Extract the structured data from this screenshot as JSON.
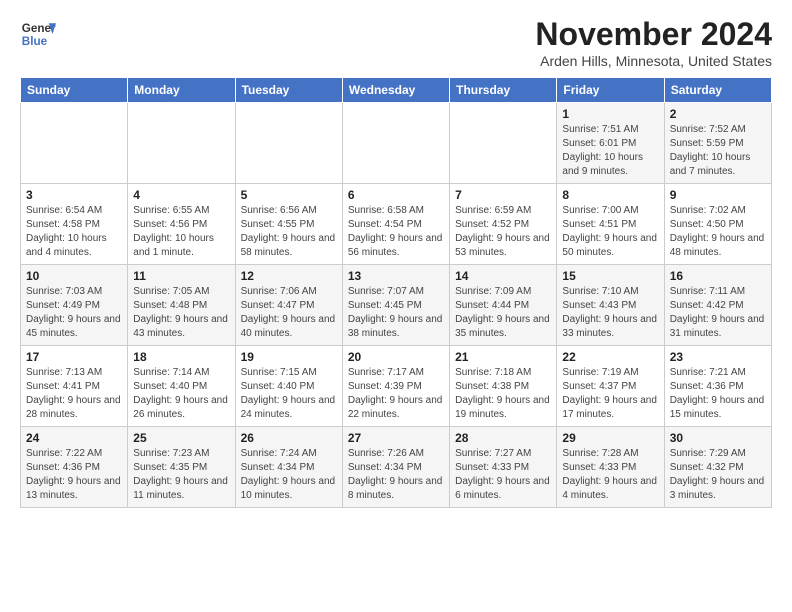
{
  "header": {
    "logo_line1": "General",
    "logo_line2": "Blue",
    "month": "November 2024",
    "location": "Arden Hills, Minnesota, United States"
  },
  "days_of_week": [
    "Sunday",
    "Monday",
    "Tuesday",
    "Wednesday",
    "Thursday",
    "Friday",
    "Saturday"
  ],
  "weeks": [
    [
      {
        "day": "",
        "info": ""
      },
      {
        "day": "",
        "info": ""
      },
      {
        "day": "",
        "info": ""
      },
      {
        "day": "",
        "info": ""
      },
      {
        "day": "",
        "info": ""
      },
      {
        "day": "1",
        "info": "Sunrise: 7:51 AM\nSunset: 6:01 PM\nDaylight: 10 hours and 9 minutes."
      },
      {
        "day": "2",
        "info": "Sunrise: 7:52 AM\nSunset: 5:59 PM\nDaylight: 10 hours and 7 minutes."
      }
    ],
    [
      {
        "day": "3",
        "info": "Sunrise: 6:54 AM\nSunset: 4:58 PM\nDaylight: 10 hours and 4 minutes."
      },
      {
        "day": "4",
        "info": "Sunrise: 6:55 AM\nSunset: 4:56 PM\nDaylight: 10 hours and 1 minute."
      },
      {
        "day": "5",
        "info": "Sunrise: 6:56 AM\nSunset: 4:55 PM\nDaylight: 9 hours and 58 minutes."
      },
      {
        "day": "6",
        "info": "Sunrise: 6:58 AM\nSunset: 4:54 PM\nDaylight: 9 hours and 56 minutes."
      },
      {
        "day": "7",
        "info": "Sunrise: 6:59 AM\nSunset: 4:52 PM\nDaylight: 9 hours and 53 minutes."
      },
      {
        "day": "8",
        "info": "Sunrise: 7:00 AM\nSunset: 4:51 PM\nDaylight: 9 hours and 50 minutes."
      },
      {
        "day": "9",
        "info": "Sunrise: 7:02 AM\nSunset: 4:50 PM\nDaylight: 9 hours and 48 minutes."
      }
    ],
    [
      {
        "day": "10",
        "info": "Sunrise: 7:03 AM\nSunset: 4:49 PM\nDaylight: 9 hours and 45 minutes."
      },
      {
        "day": "11",
        "info": "Sunrise: 7:05 AM\nSunset: 4:48 PM\nDaylight: 9 hours and 43 minutes."
      },
      {
        "day": "12",
        "info": "Sunrise: 7:06 AM\nSunset: 4:47 PM\nDaylight: 9 hours and 40 minutes."
      },
      {
        "day": "13",
        "info": "Sunrise: 7:07 AM\nSunset: 4:45 PM\nDaylight: 9 hours and 38 minutes."
      },
      {
        "day": "14",
        "info": "Sunrise: 7:09 AM\nSunset: 4:44 PM\nDaylight: 9 hours and 35 minutes."
      },
      {
        "day": "15",
        "info": "Sunrise: 7:10 AM\nSunset: 4:43 PM\nDaylight: 9 hours and 33 minutes."
      },
      {
        "day": "16",
        "info": "Sunrise: 7:11 AM\nSunset: 4:42 PM\nDaylight: 9 hours and 31 minutes."
      }
    ],
    [
      {
        "day": "17",
        "info": "Sunrise: 7:13 AM\nSunset: 4:41 PM\nDaylight: 9 hours and 28 minutes."
      },
      {
        "day": "18",
        "info": "Sunrise: 7:14 AM\nSunset: 4:40 PM\nDaylight: 9 hours and 26 minutes."
      },
      {
        "day": "19",
        "info": "Sunrise: 7:15 AM\nSunset: 4:40 PM\nDaylight: 9 hours and 24 minutes."
      },
      {
        "day": "20",
        "info": "Sunrise: 7:17 AM\nSunset: 4:39 PM\nDaylight: 9 hours and 22 minutes."
      },
      {
        "day": "21",
        "info": "Sunrise: 7:18 AM\nSunset: 4:38 PM\nDaylight: 9 hours and 19 minutes."
      },
      {
        "day": "22",
        "info": "Sunrise: 7:19 AM\nSunset: 4:37 PM\nDaylight: 9 hours and 17 minutes."
      },
      {
        "day": "23",
        "info": "Sunrise: 7:21 AM\nSunset: 4:36 PM\nDaylight: 9 hours and 15 minutes."
      }
    ],
    [
      {
        "day": "24",
        "info": "Sunrise: 7:22 AM\nSunset: 4:36 PM\nDaylight: 9 hours and 13 minutes."
      },
      {
        "day": "25",
        "info": "Sunrise: 7:23 AM\nSunset: 4:35 PM\nDaylight: 9 hours and 11 minutes."
      },
      {
        "day": "26",
        "info": "Sunrise: 7:24 AM\nSunset: 4:34 PM\nDaylight: 9 hours and 10 minutes."
      },
      {
        "day": "27",
        "info": "Sunrise: 7:26 AM\nSunset: 4:34 PM\nDaylight: 9 hours and 8 minutes."
      },
      {
        "day": "28",
        "info": "Sunrise: 7:27 AM\nSunset: 4:33 PM\nDaylight: 9 hours and 6 minutes."
      },
      {
        "day": "29",
        "info": "Sunrise: 7:28 AM\nSunset: 4:33 PM\nDaylight: 9 hours and 4 minutes."
      },
      {
        "day": "30",
        "info": "Sunrise: 7:29 AM\nSunset: 4:32 PM\nDaylight: 9 hours and 3 minutes."
      }
    ]
  ]
}
